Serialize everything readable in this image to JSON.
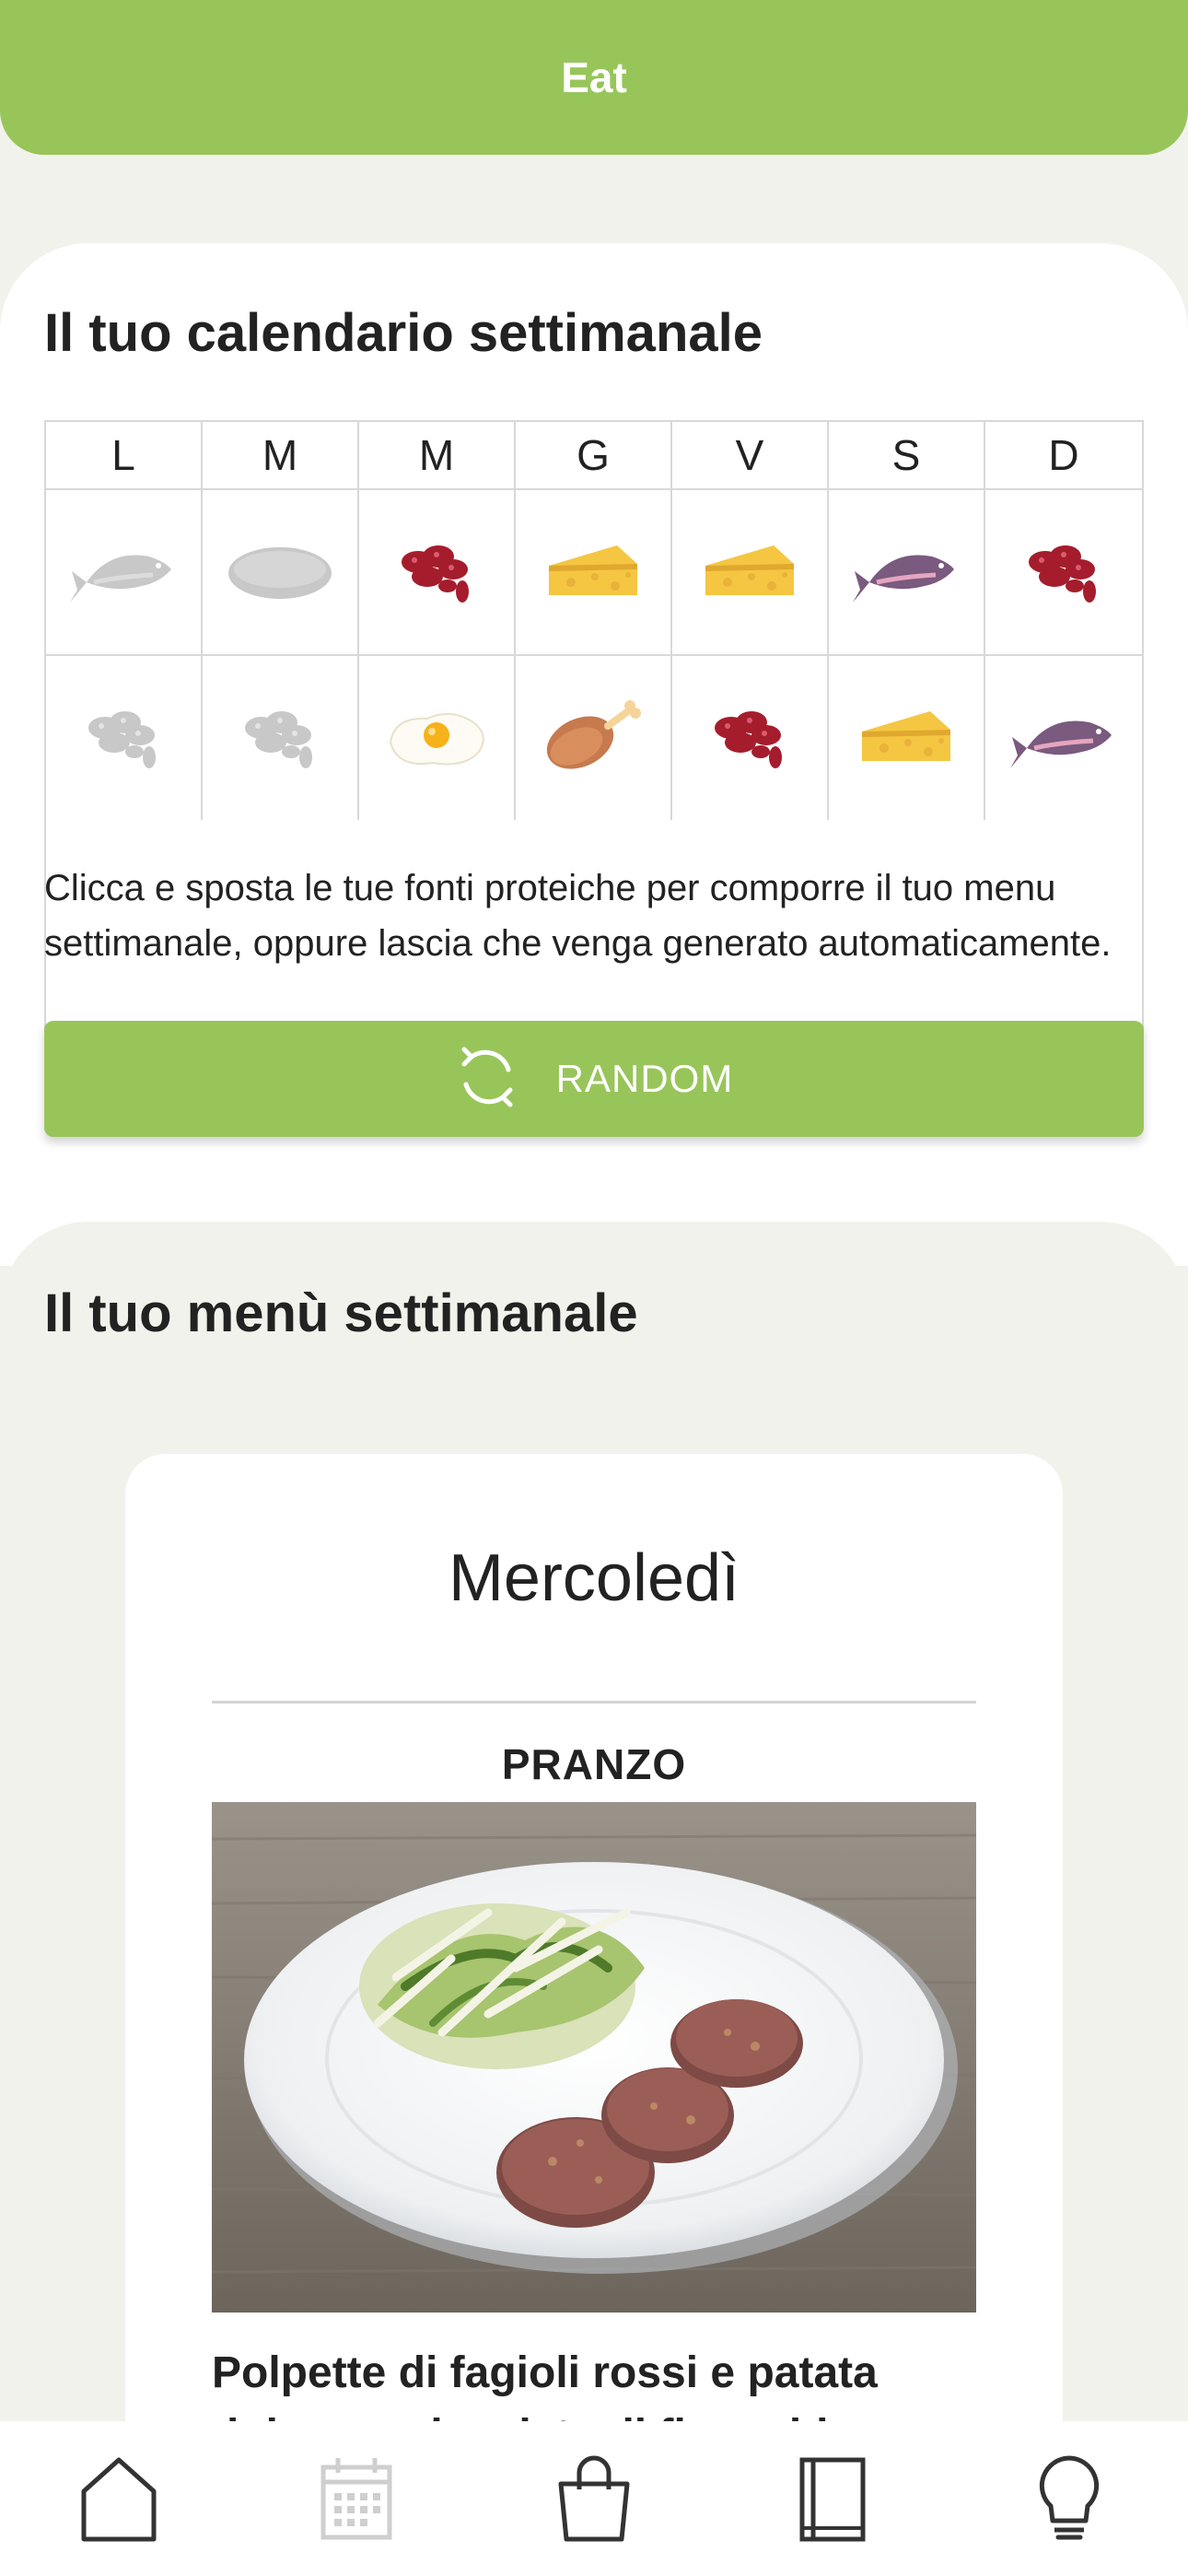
{
  "header": {
    "title": "Eat"
  },
  "calendar": {
    "title": "Il tuo calendario settimanale",
    "days": [
      "L",
      "M",
      "M",
      "G",
      "V",
      "S",
      "D"
    ],
    "row1": [
      "fish-icon",
      "mushroom-icon",
      "beans-icon",
      "cheese-icon",
      "cheese-icon",
      "fish-icon",
      "beans-icon"
    ],
    "row1_active": [
      false,
      false,
      true,
      true,
      true,
      true,
      true
    ],
    "row2": [
      "beans-icon",
      "beans-icon",
      "egg-icon",
      "chicken-leg-icon",
      "beans-icon",
      "cheese-icon",
      "fish-icon"
    ],
    "row2_active": [
      false,
      false,
      true,
      true,
      true,
      true,
      true
    ],
    "help_text": "Clicca e sposta le tue fonti proteiche per comporre il tuo menu settimanale, oppure lascia che venga generato automaticamente.",
    "random_label": "RANDOM"
  },
  "menu": {
    "title": "Il tuo menù settimanale",
    "day": "Mercoledì",
    "meal": "PRANZO",
    "dish_name": "Polpette di fagioli rossi e patata dolce con insalata di finocchio"
  },
  "colors": {
    "brand_green": "#98c55a",
    "cheese": "#f5c642",
    "beans": "#a51d2d",
    "fish": "#7a5a7e",
    "inactive": "#c8c8c8"
  },
  "nav": [
    "home-icon",
    "calendar-icon",
    "shopping-bag-icon",
    "book-icon",
    "lightbulb-icon"
  ]
}
